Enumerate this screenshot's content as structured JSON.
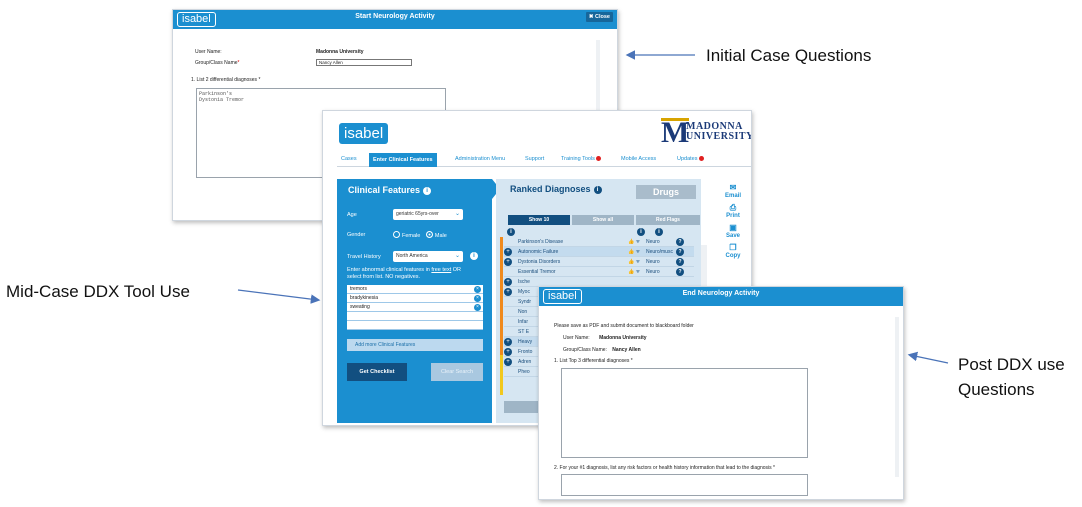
{
  "annotations": {
    "initial": "Initial Case Questions",
    "mid": "Mid-Case DDX Tool Use",
    "post_line1": "Post DDX use",
    "post_line2": "Questions"
  },
  "colors": {
    "isabel_blue": "#1b8fd0",
    "dark_blue": "#124f80",
    "alert_red": "#e02020",
    "mu_gold": "#d8a400",
    "mu_navy": "#1b3a78"
  },
  "initial_window": {
    "logo": "isabel",
    "title": "Start Neurology Activity",
    "close_label": "Close",
    "user_name_label": "User Name:",
    "user_name_value": "Madonna University",
    "group_label": "Group/Class Name",
    "group_required": "*",
    "group_value": "Nancy Allen",
    "question1": "1. List 2 differential diagnoses *",
    "answer1_line1": "Parkinson's",
    "answer1_line2": "Dystonia Tremor"
  },
  "mid_window": {
    "logo": "isabel",
    "university_letter": "M",
    "university_line1": "MADONNA",
    "university_line2": "UNIVERSITY",
    "nav": [
      {
        "label": "Cases"
      },
      {
        "label": "Enter Clinical Features"
      },
      {
        "label": "Administration Menu"
      },
      {
        "label": "Support"
      },
      {
        "label": "Training Tools"
      },
      {
        "label": "Mobile Access"
      },
      {
        "label": "Updates"
      }
    ],
    "clinical_features": {
      "title": "Clinical Features",
      "age_label": "Age",
      "age_value": "geriatric 65yrs-over",
      "gender_label": "Gender",
      "gender_female": "Female",
      "gender_male": "Male",
      "gender_selected": "Male",
      "travel_label": "Travel History",
      "travel_value": "North America",
      "instructions_part1": "Enter abnormal clinical features in ",
      "instructions_link": "free text",
      "instructions_part2": " OR",
      "instructions_line2": "select from list. NO negatives.",
      "features": [
        "tremors",
        "bradykinesia",
        "sweating",
        "",
        ""
      ],
      "add_more": "Add more Clinical Features",
      "get_checklist": "Get Checklist",
      "clear_search": "Clear Search"
    },
    "ranked": {
      "title": "Ranked Diagnoses",
      "drugs_tab": "Drugs",
      "tabs": [
        "Show 10",
        "Show all",
        "Red Flags"
      ],
      "rows": [
        {
          "name": "Parkinson's Disease",
          "category": "Neuro",
          "plus": false
        },
        {
          "name": "Autonomic Failure",
          "category": "Neuro/musc",
          "plus": true
        },
        {
          "name": "Dystonia Disorders",
          "category": "Neuro",
          "plus": true
        },
        {
          "name": "Essential Tremor",
          "category": "Neuro",
          "plus": false
        },
        {
          "name": "Ische",
          "category": "",
          "plus": true
        },
        {
          "name": "Myoc",
          "category": "",
          "plus": true
        },
        {
          "name": "Syndr",
          "category": "",
          "plus": false
        },
        {
          "name": "Non",
          "category": "",
          "plus": false
        },
        {
          "name": "Infar",
          "category": "",
          "plus": false
        },
        {
          "name": "ST E",
          "category": "",
          "plus": false
        },
        {
          "name": "Heavy",
          "category": "",
          "plus": true
        },
        {
          "name": "Fronto",
          "category": "",
          "plus": true
        },
        {
          "name": "Adren",
          "category": "",
          "plus": true
        },
        {
          "name": "Pheo",
          "category": "",
          "plus": false
        }
      ]
    },
    "tools": [
      {
        "label": "Email",
        "icon": "envelope-icon",
        "glyph": "✉"
      },
      {
        "label": "Print",
        "icon": "printer-icon",
        "glyph": "⎙"
      },
      {
        "label": "Save",
        "icon": "save-icon",
        "glyph": "▣"
      },
      {
        "label": "Copy",
        "icon": "copy-icon",
        "glyph": "❐"
      }
    ]
  },
  "post_window": {
    "logo": "isabel",
    "title": "End Neurology Activity",
    "instruction": "Please save as PDF and submit document to blackboard folder",
    "user_name_label": "User Name:",
    "user_name_value": "Madonna University",
    "group_label": "Group/Class Name:",
    "group_value": "Nancy Allen",
    "question1": "1. List Top 3 differential diagnoses *",
    "question2": "2. For your #1 diagnosis, list any risk factors or health history information that lead to the diagnosis *"
  }
}
